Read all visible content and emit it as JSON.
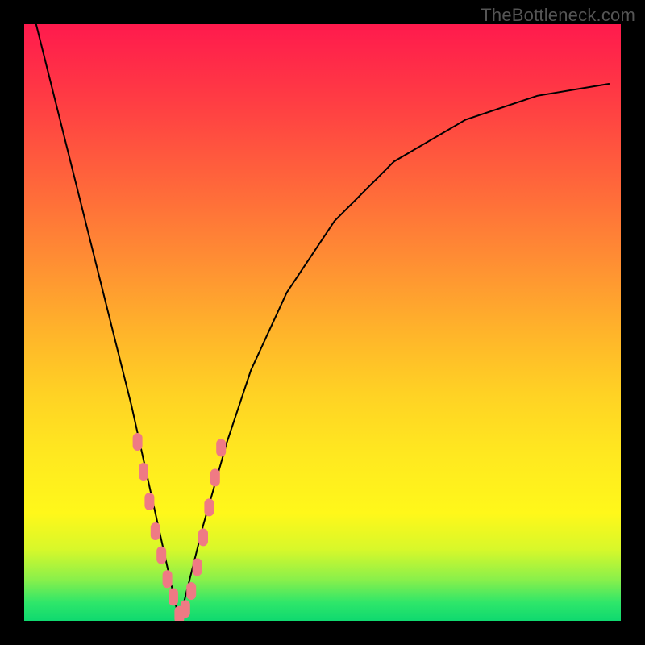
{
  "watermark": "TheBottleneck.com",
  "chart_data": {
    "type": "line",
    "title": "",
    "xlabel": "",
    "ylabel": "",
    "xlim": [
      0,
      100
    ],
    "ylim": [
      0,
      100
    ],
    "background_gradient": {
      "top": "#ff1a4d",
      "mid_upper": "#ff8f33",
      "mid_lower": "#ffe820",
      "bottom": "#0fd96f",
      "meaning": "top=worse, bottom=optimal"
    },
    "curve": {
      "description": "V-shaped bottleneck curve; minimum ≈ optimal component match",
      "min_x": 26,
      "left_branch_x": [
        2,
        4,
        6,
        8,
        10,
        12,
        14,
        16,
        18,
        20,
        22,
        24,
        26
      ],
      "left_branch_y": [
        100,
        92,
        84,
        76,
        68,
        60,
        52,
        44,
        36,
        27,
        18,
        9,
        0
      ],
      "right_branch_x": [
        26,
        30,
        34,
        38,
        44,
        52,
        62,
        74,
        86,
        98
      ],
      "right_branch_y": [
        0,
        16,
        30,
        42,
        55,
        67,
        77,
        84,
        88,
        90
      ]
    },
    "sample_points": {
      "color": "#ef7a84",
      "description": "clustered near the curve minimum on both branches",
      "points": [
        {
          "x": 19,
          "y": 30
        },
        {
          "x": 20,
          "y": 25
        },
        {
          "x": 21,
          "y": 20
        },
        {
          "x": 22,
          "y": 15
        },
        {
          "x": 23,
          "y": 11
        },
        {
          "x": 24,
          "y": 7
        },
        {
          "x": 25,
          "y": 4
        },
        {
          "x": 26,
          "y": 1
        },
        {
          "x": 27,
          "y": 2
        },
        {
          "x": 28,
          "y": 5
        },
        {
          "x": 29,
          "y": 9
        },
        {
          "x": 30,
          "y": 14
        },
        {
          "x": 31,
          "y": 19
        },
        {
          "x": 32,
          "y": 24
        },
        {
          "x": 33,
          "y": 29
        }
      ]
    }
  }
}
